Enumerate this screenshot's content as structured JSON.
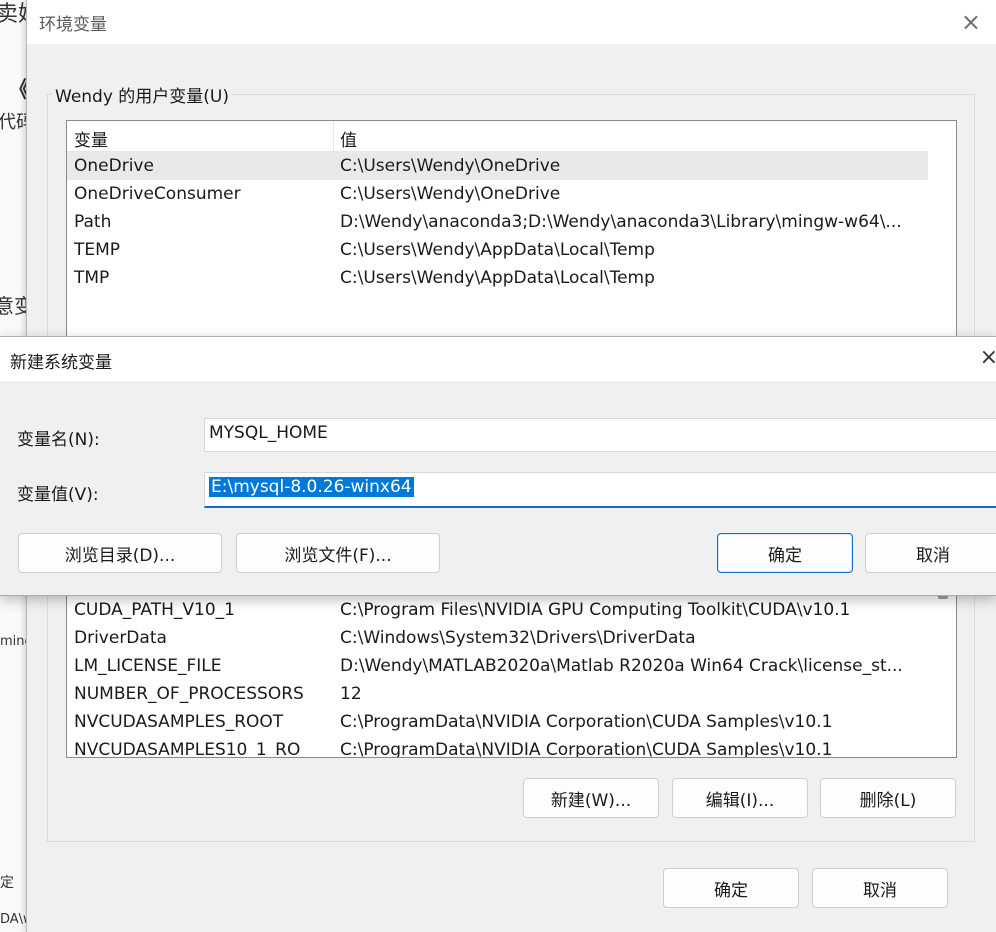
{
  "background_app": {
    "frag1": "卖妈",
    "frag2": "《/",
    "frag3": "代码",
    "frag4": "意变",
    "frag5": "ming",
    "frag6": "定",
    "frag7": "DA\\w"
  },
  "env_window": {
    "title": "环境变量",
    "close_icon": "×",
    "user_group_label": "Wendy 的用户变量(U)",
    "user_columns": [
      "变量",
      "值"
    ],
    "user_vars": [
      {
        "name": "OneDrive",
        "value": "C:\\Users\\Wendy\\OneDrive"
      },
      {
        "name": "OneDriveConsumer",
        "value": "C:\\Users\\Wendy\\OneDrive"
      },
      {
        "name": "Path",
        "value": "D:\\Wendy\\anaconda3;D:\\Wendy\\anaconda3\\Library\\mingw-w64\\..."
      },
      {
        "name": "TEMP",
        "value": "C:\\Users\\Wendy\\AppData\\Local\\Temp"
      },
      {
        "name": "TMP",
        "value": "C:\\Users\\Wendy\\AppData\\Local\\Temp"
      }
    ],
    "system_vars": [
      {
        "name": "CUDA_PATH_V10_1",
        "value": "C:\\Program Files\\NVIDIA GPU Computing Toolkit\\CUDA\\v10.1"
      },
      {
        "name": "DriverData",
        "value": "C:\\Windows\\System32\\Drivers\\DriverData"
      },
      {
        "name": "LM_LICENSE_FILE",
        "value": "D:\\Wendy\\MATLAB2020a\\Matlab R2020a Win64 Crack\\license_st..."
      },
      {
        "name": "NUMBER_OF_PROCESSORS",
        "value": "12"
      },
      {
        "name": "NVCUDASAMPLES_ROOT",
        "value": "C:\\ProgramData\\NVIDIA Corporation\\CUDA Samples\\v10.1"
      },
      {
        "name": "NVCUDASAMPLES10_1_RO",
        "value": "C:\\ProgramData\\NVIDIA Corporation\\CUDA Samples\\v10.1"
      }
    ],
    "system_buttons": {
      "new": "新建(W)...",
      "edit": "编辑(I)...",
      "delete": "删除(L)"
    },
    "ok": "确定",
    "cancel": "取消"
  },
  "new_dialog": {
    "title": "新建系统变量",
    "close_icon": "×",
    "name_label": "变量名(N):",
    "name_value": "MYSQL_HOME",
    "value_label": "变量值(V):",
    "value_value": "E:\\mysql-8.0.26-winx64",
    "browse_dir": "浏览目录(D)...",
    "browse_file": "浏览文件(F)...",
    "ok": "确定",
    "cancel": "取消"
  }
}
